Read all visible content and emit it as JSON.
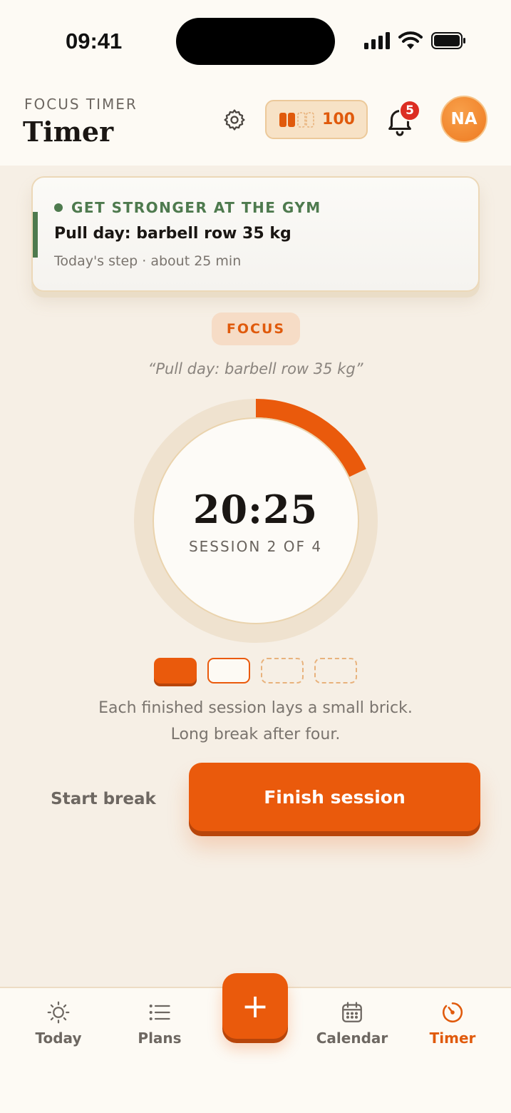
{
  "status_bar": {
    "time": "09:41"
  },
  "header": {
    "kicker": "FOCUS TIMER",
    "title": "Timer",
    "brick_count": "100",
    "notification_count": "5",
    "avatar_initials": "NA"
  },
  "goal_card": {
    "goal": "GET STRONGER AT THE GYM",
    "task": "Pull day: barbell row 35 kg",
    "subtitle": "Today's step · about 25 min"
  },
  "timer": {
    "mode": "FOCUS",
    "task_quote": "“Pull day: barbell row 35 kg”",
    "time_remaining": "20:25",
    "session_label": "SESSION 2 OF 4",
    "progress_fraction": 0.18,
    "sessions_total": 4,
    "sessions_done": 1,
    "hint": "Each finished session lays a small brick. Long break after four."
  },
  "actions": {
    "secondary_label": "Start break",
    "primary_label": "Finish session"
  },
  "tabbar": {
    "fab_label": "+",
    "items": [
      {
        "label": "Today",
        "icon": "sun-icon"
      },
      {
        "label": "Plans",
        "icon": "list-icon"
      },
      {
        "label": "Calendar",
        "icon": "calendar-icon"
      },
      {
        "label": "Timer",
        "icon": "timer-icon",
        "active": true
      }
    ]
  },
  "colors": {
    "accent": "#ea5a0c",
    "goal_green": "#4e7a4e",
    "badge_red": "#dc2d22",
    "background": "#f6efe5"
  }
}
